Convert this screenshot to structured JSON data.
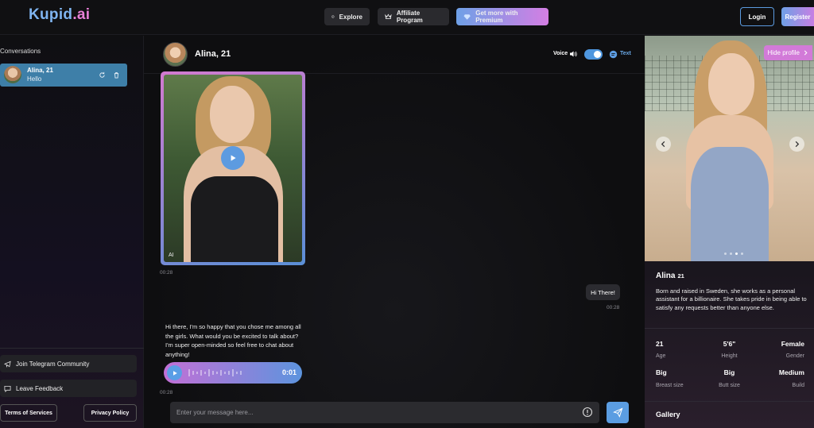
{
  "header": {
    "logo_main": "Kupid",
    "logo_suffix": ".ai",
    "explore_label": "Explore",
    "affiliate_label": "Affiliate Program",
    "premium_label": "Get more with Premium",
    "login_label": "Login",
    "register_label": "Register"
  },
  "sidebar": {
    "title": "Conversations",
    "conversations": [
      {
        "name": "Alina, 21",
        "last_message": "Hello"
      }
    ],
    "telegram_label": "Join Telegram Community",
    "feedback_label": "Leave Feedback",
    "terms_label": "Terms of Services",
    "privacy_label": "Privacy Policy"
  },
  "chat": {
    "name": "Alina, 21",
    "voice_label": "Voice",
    "voice_enabled": true,
    "text_label": "Text",
    "ai_badge": "AI",
    "messages": [
      {
        "type": "image",
        "time": "00:28"
      },
      {
        "type": "user",
        "text": "Hi There!",
        "time": "00:28"
      },
      {
        "type": "ai",
        "text": "Hi there, I'm so happy that you chose me among all the girls. What would you be excited to talk about? I'm super open-minded so feel free to chat about anything!",
        "audio_time": "0:01",
        "time": "00:28"
      }
    ],
    "input_placeholder": "Enter your message here..."
  },
  "profile": {
    "hide_label": "Hide profile",
    "name": "Alina",
    "age": "21",
    "bio": "Born and raised in Sweden, she works as a personal assistant for a billionaire. She takes pride in being able to satisfy any requests better than anyone else.",
    "stats": [
      {
        "value": "21",
        "label": "Age"
      },
      {
        "value": "5'6\"",
        "label": "Height"
      },
      {
        "value": "Female",
        "label": "Gender"
      },
      {
        "value": "Big",
        "label": "Breast size"
      },
      {
        "value": "Big",
        "label": "Butt size"
      },
      {
        "value": "Medium",
        "label": "Build"
      }
    ],
    "gallery_label": "Gallery",
    "carousel_dots": 4,
    "active_dot": 3
  },
  "colors": {
    "accent_blue": "#5b9de2",
    "accent_pink": "#d27ad8",
    "background": "#0e0e10"
  }
}
